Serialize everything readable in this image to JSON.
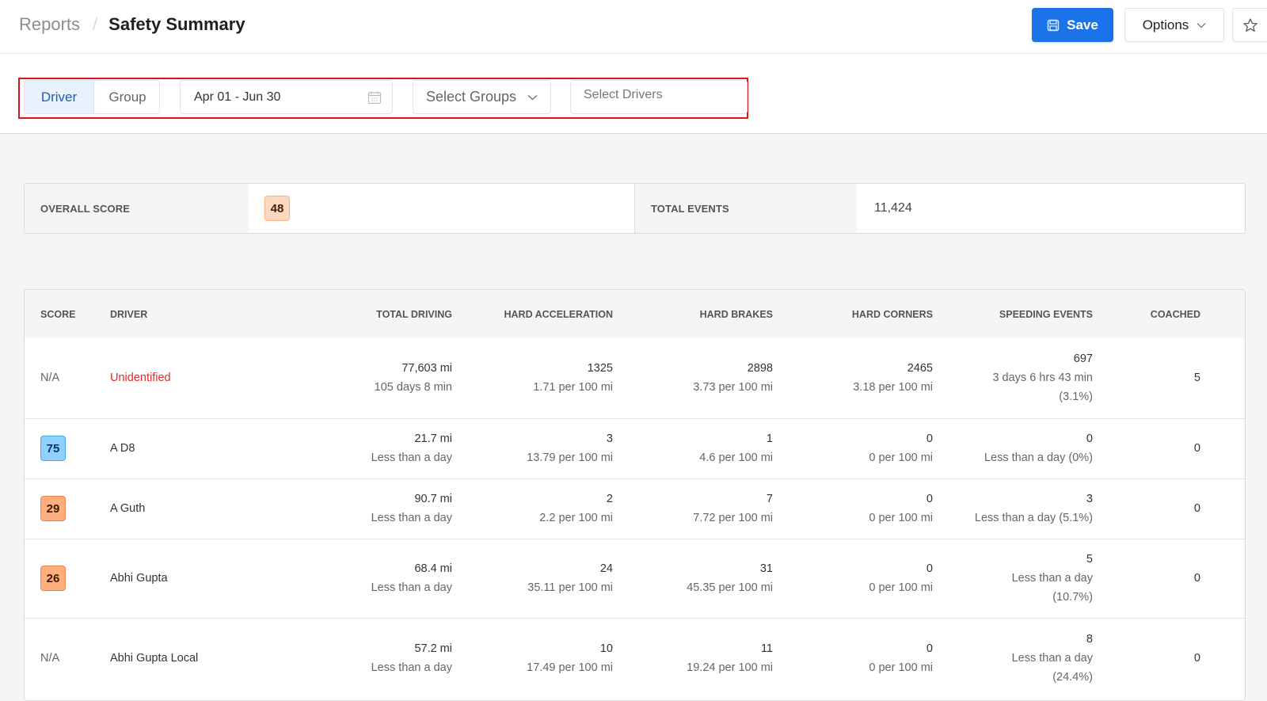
{
  "header": {
    "breadcrumb_parent": "Reports",
    "breadcrumb_separator": "/",
    "title": "Safety Summary",
    "save_label": "Save",
    "options_label": "Options"
  },
  "filters": {
    "view_toggle": [
      {
        "label": "Driver",
        "active": true
      },
      {
        "label": "Group",
        "active": false
      }
    ],
    "date_range": "Apr 01 - Jun 30",
    "groups_placeholder": "Select Groups",
    "drivers_placeholder": "Select Drivers",
    "drivers_value": ""
  },
  "summary": {
    "overall_score_label": "OVERALL SCORE",
    "overall_score": "48",
    "total_events_label": "TOTAL EVENTS",
    "total_events": "11,424"
  },
  "table": {
    "columns": [
      "SCORE",
      "DRIVER",
      "TOTAL DRIVING",
      "HARD ACCELERATION",
      "HARD BRAKES",
      "HARD CORNERS",
      "SPEEDING EVENTS",
      "COACHED"
    ],
    "rows": [
      {
        "score": "N/A",
        "score_color": "",
        "driver": "Unidentified",
        "total_driving": "77,603 mi",
        "total_time": "105 days 8 min",
        "hard_accel": "1325",
        "hard_accel_rate": "1.71 per 100 mi",
        "hard_brakes": "2898",
        "hard_brakes_rate": "3.73 per 100 mi",
        "hard_corners": "2465",
        "hard_corners_rate": "3.18 per 100 mi",
        "speeding": "697",
        "speeding_time": "3 days 6 hrs 43 min",
        "speeding_pct": "(3.1%)",
        "coached": "5"
      },
      {
        "score": "75",
        "score_color": "#8fd0ff",
        "driver": "A D8",
        "total_driving": "21.7 mi",
        "total_time": "Less than a day",
        "hard_accel": "3",
        "hard_accel_rate": "13.79 per 100 mi",
        "hard_brakes": "1",
        "hard_brakes_rate": "4.6 per 100 mi",
        "hard_corners": "0",
        "hard_corners_rate": "0 per 100 mi",
        "speeding": "0",
        "speeding_time": "Less than a day (0%)",
        "speeding_pct": "",
        "coached": "0"
      },
      {
        "score": "29",
        "score_color": "#ffae7e",
        "driver": "A Guth",
        "total_driving": "90.7 mi",
        "total_time": "Less than a day",
        "hard_accel": "2",
        "hard_accel_rate": "2.2 per 100 mi",
        "hard_brakes": "7",
        "hard_brakes_rate": "7.72 per 100 mi",
        "hard_corners": "0",
        "hard_corners_rate": "0 per 100 mi",
        "speeding": "3",
        "speeding_time": "Less than a day (5.1%)",
        "speeding_pct": "",
        "coached": "0"
      },
      {
        "score": "26",
        "score_color": "#ffae7e",
        "driver": "Abhi Gupta",
        "total_driving": "68.4 mi",
        "total_time": "Less than a day",
        "hard_accel": "24",
        "hard_accel_rate": "35.11 per 100 mi",
        "hard_brakes": "31",
        "hard_brakes_rate": "45.35 per 100 mi",
        "hard_corners": "0",
        "hard_corners_rate": "0 per 100 mi",
        "speeding": "5",
        "speeding_time": "Less than a day",
        "speeding_pct": "(10.7%)",
        "coached": "0"
      },
      {
        "score": "N/A",
        "score_color": "",
        "driver": "Abhi Gupta Local",
        "total_driving": "57.2 mi",
        "total_time": "Less than a day",
        "hard_accel": "10",
        "hard_accel_rate": "17.49 per 100 mi",
        "hard_brakes": "11",
        "hard_brakes_rate": "19.24 per 100 mi",
        "hard_corners": "0",
        "hard_corners_rate": "0 per 100 mi",
        "speeding": "8",
        "speeding_time": "Less than a day",
        "speeding_pct": "(24.4%)",
        "coached": "0"
      }
    ]
  },
  "colors": {
    "primary": "#1a73e8",
    "highlight_border": "#d9141b",
    "alert_text": "#e12b2b",
    "score_good": "#8fd0ff",
    "score_poor": "#ffae7e",
    "score_fair": "#fdd8bf"
  }
}
